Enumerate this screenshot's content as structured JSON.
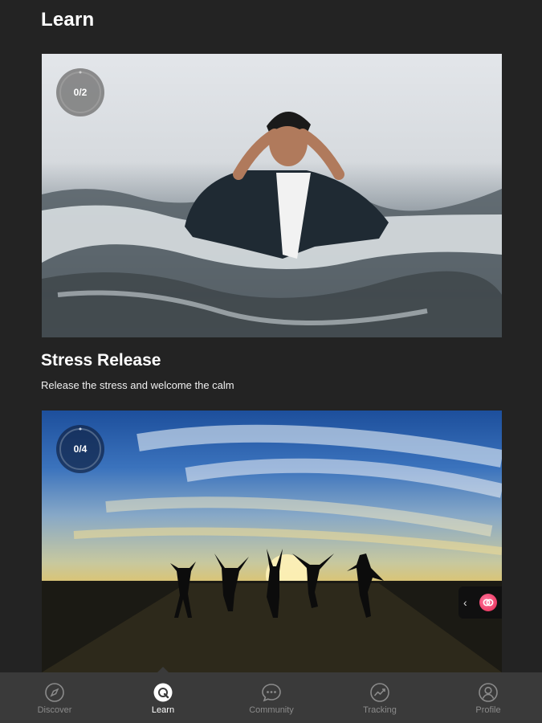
{
  "header": {
    "title": "Learn"
  },
  "cards": [
    {
      "progress_label": "0/2",
      "progress_fraction": 0.0,
      "title": "Stress Release",
      "subtitle": "Release the stress and welcome the calm",
      "image": "man-in-ocean-waves-photo"
    },
    {
      "progress_label": "0/4",
      "progress_fraction": 0.0,
      "image": "people-jumping-at-sunset-photo"
    }
  ],
  "side_widget": {
    "chevron": "‹",
    "icon": "app-badge-icon"
  },
  "bottom_nav": {
    "active": "learn",
    "items": [
      {
        "id": "discover",
        "label": "Discover",
        "icon": "compass-icon"
      },
      {
        "id": "learn",
        "label": "Learn",
        "icon": "learn-icon"
      },
      {
        "id": "community",
        "label": "Community",
        "icon": "chat-bubble-icon"
      },
      {
        "id": "tracking",
        "label": "Tracking",
        "icon": "trend-chart-icon"
      },
      {
        "id": "profile",
        "label": "Profile",
        "icon": "user-icon"
      }
    ]
  },
  "colors": {
    "background": "#232323",
    "nav_background": "#3a3a3a",
    "nav_inactive": "#8b8b8b",
    "nav_active": "#ffffff"
  }
}
